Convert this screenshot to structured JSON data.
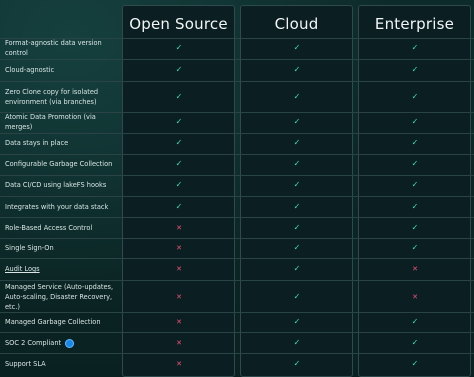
{
  "columns": [
    "Open Source",
    "Cloud",
    "Enterprise"
  ],
  "marks": {
    "yes": "✓",
    "no": "✕"
  },
  "colors": {
    "check": "#3ee0b8",
    "cross": "#f0527a",
    "badge": "#1a86e6"
  },
  "rows": [
    {
      "feature": "Format-agnostic data version control",
      "values": [
        "yes",
        "yes",
        "yes"
      ]
    },
    {
      "feature": "Cloud-agnostic",
      "values": [
        "yes",
        "yes",
        "yes"
      ]
    },
    {
      "feature": "Zero Clone copy for isolated environment (via branches)",
      "values": [
        "yes",
        "yes",
        "yes"
      ]
    },
    {
      "feature": "Atomic Data Promotion (via merges)",
      "values": [
        "yes",
        "yes",
        "yes"
      ]
    },
    {
      "feature": "Data stays in place",
      "values": [
        "yes",
        "yes",
        "yes"
      ]
    },
    {
      "feature": "Configurable Garbage Collection",
      "values": [
        "yes",
        "yes",
        "yes"
      ]
    },
    {
      "feature": "Data CI/CD using lakeFS hooks",
      "values": [
        "yes",
        "yes",
        "yes"
      ]
    },
    {
      "feature": "Integrates with your data stack",
      "values": [
        "yes",
        "yes",
        "yes"
      ]
    },
    {
      "feature": "Role-Based Access Control",
      "values": [
        "no",
        "yes",
        "yes"
      ]
    },
    {
      "feature": "Single Sign-On",
      "values": [
        "no",
        "yes",
        "yes"
      ]
    },
    {
      "feature": "Audit Logs",
      "values": [
        "no",
        "yes",
        "no"
      ],
      "link": true
    },
    {
      "feature": "Managed Service (Auto-updates, Auto-scaling, Disaster Recovery, etc.)",
      "values": [
        "no",
        "yes",
        "no"
      ]
    },
    {
      "feature": "Managed Garbage Collection",
      "values": [
        "no",
        "yes",
        "yes"
      ]
    },
    {
      "feature": "SOC 2 Compliant",
      "values": [
        "no",
        "yes",
        "yes"
      ],
      "badge": "soc2-badge-icon"
    },
    {
      "feature": "Support SLA",
      "values": [
        "no",
        "yes",
        "yes"
      ]
    }
  ]
}
